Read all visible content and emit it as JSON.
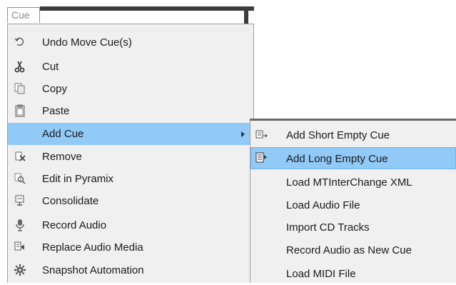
{
  "menubar": {
    "cue_tab": "Cue"
  },
  "menu": {
    "items": [
      {
        "label": "Undo Move Cue(s)",
        "icon": "undo-icon"
      },
      {
        "label": "Cut",
        "icon": "scissors-icon"
      },
      {
        "label": "Copy",
        "icon": "copy-icon"
      },
      {
        "label": "Paste",
        "icon": "paste-icon"
      },
      {
        "label": "Add Cue",
        "icon": "",
        "highlighted": true,
        "has_submenu": true
      },
      {
        "label": "Remove",
        "icon": "remove-icon"
      },
      {
        "label": "Edit in Pyramix",
        "icon": "edit-magnifier-icon"
      },
      {
        "label": "Consolidate",
        "icon": "consolidate-icon"
      },
      {
        "label": "Record Audio",
        "icon": "microphone-icon"
      },
      {
        "label": "Replace Audio Media",
        "icon": "replace-audio-icon"
      },
      {
        "label": "Snapshot Automation",
        "icon": "gear-icon"
      }
    ]
  },
  "submenu": {
    "items": [
      {
        "label": "Add Short Empty Cue",
        "icon": "short-cue-icon"
      },
      {
        "label": "Add Long Empty Cue",
        "icon": "long-cue-icon",
        "highlighted": true
      },
      {
        "label": "Load MTInterChange XML",
        "icon": ""
      },
      {
        "label": "Load Audio File",
        "icon": ""
      },
      {
        "label": "Import CD Tracks",
        "icon": ""
      },
      {
        "label": "Record Audio as New Cue",
        "icon": ""
      },
      {
        "label": "Load MIDI File",
        "icon": ""
      }
    ]
  },
  "colors": {
    "highlight": "#91c9f7",
    "menu_bg": "#f0f0f0"
  }
}
